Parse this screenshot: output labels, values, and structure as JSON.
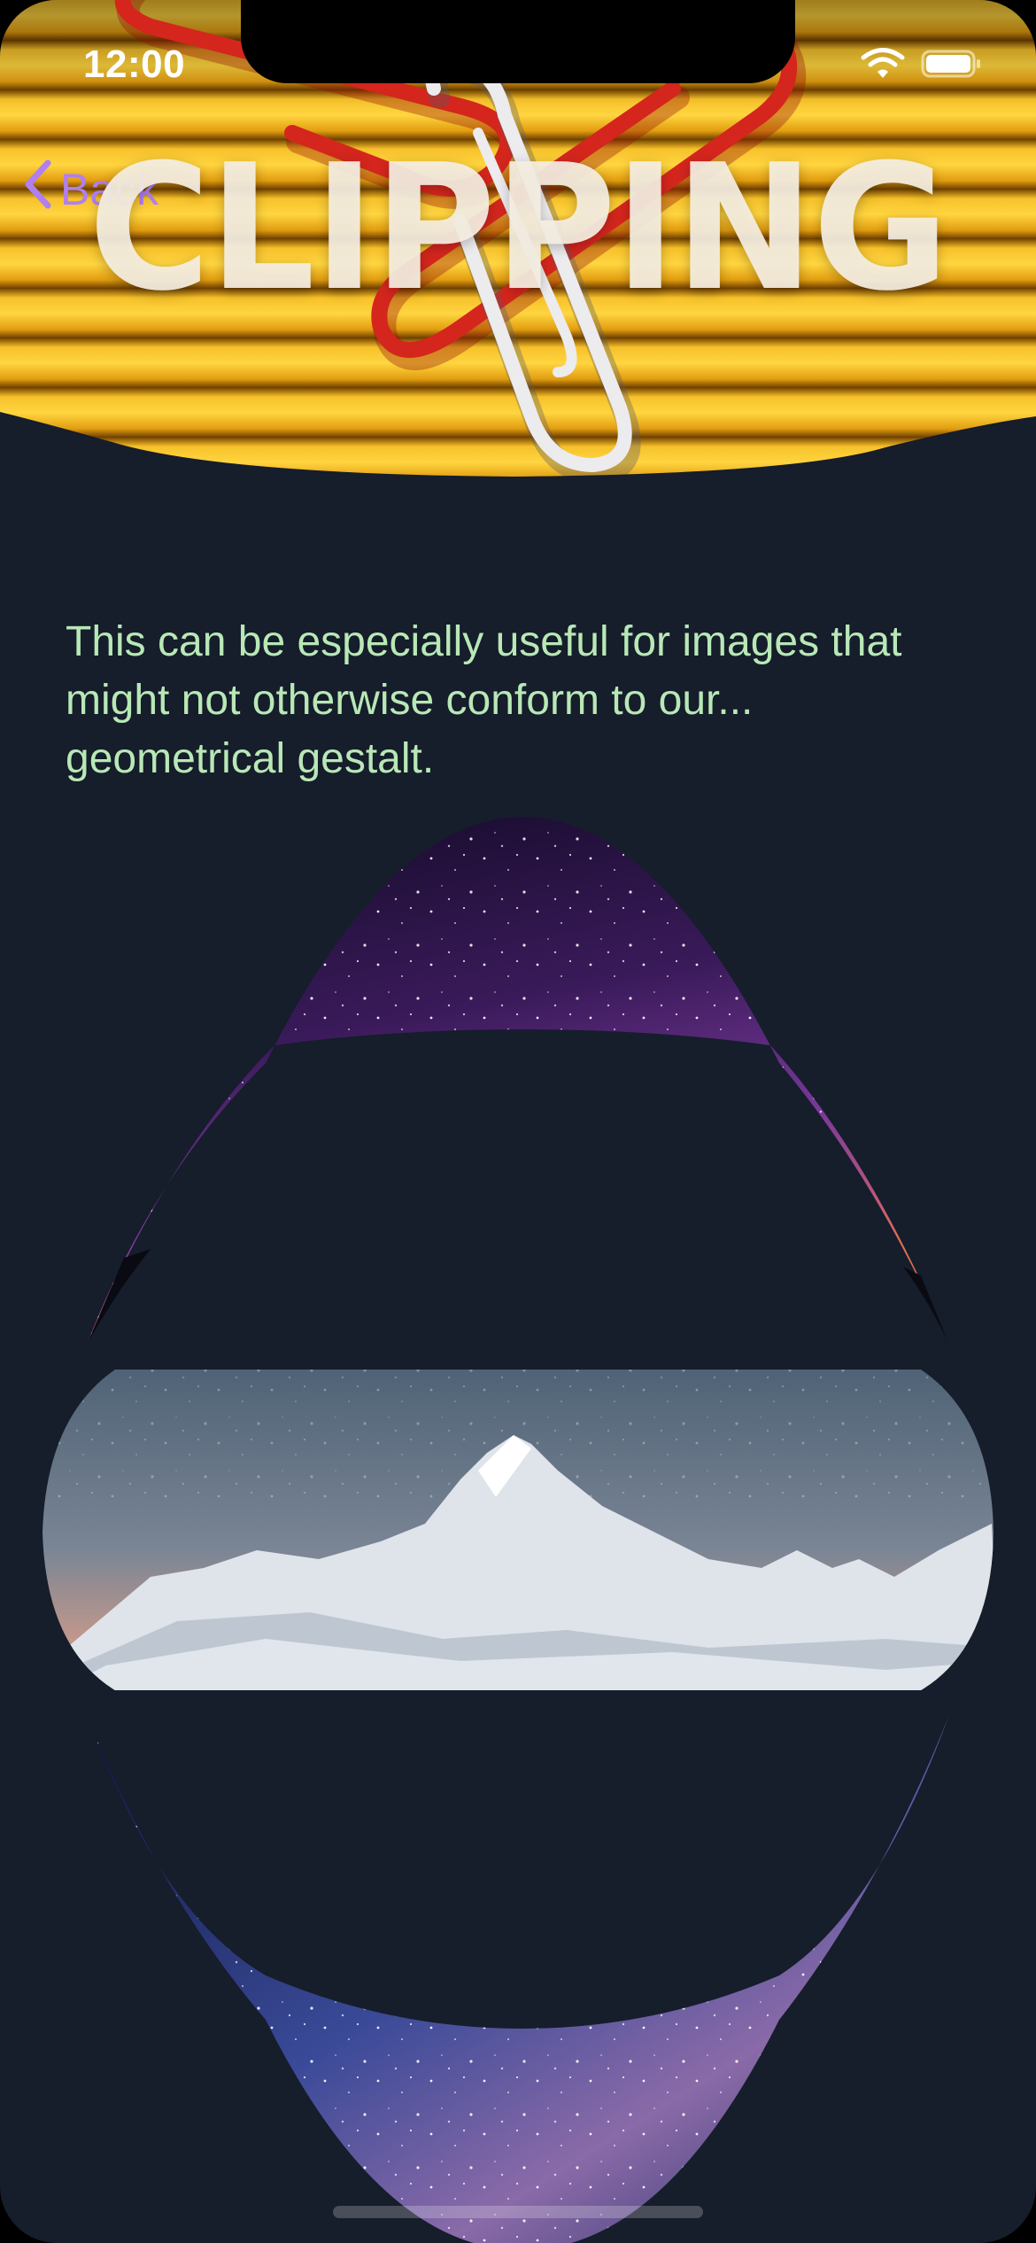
{
  "status_bar": {
    "time": "12:00"
  },
  "nav": {
    "back_label": "Back"
  },
  "header": {
    "title": "CLIPPING"
  },
  "content": {
    "paragraph": "This can be especially useful for images that might not otherwise conform to our... geometrical gestalt."
  },
  "colors": {
    "background": "#161d2b",
    "accent": "#b07ff0",
    "body_text": "#b8e8b6",
    "header_yellow": "#f2b51a",
    "clip_red": "#d2231c"
  },
  "icons": {
    "back": "chevron-left-icon",
    "wifi": "wifi-icon",
    "battery": "battery-icon"
  }
}
